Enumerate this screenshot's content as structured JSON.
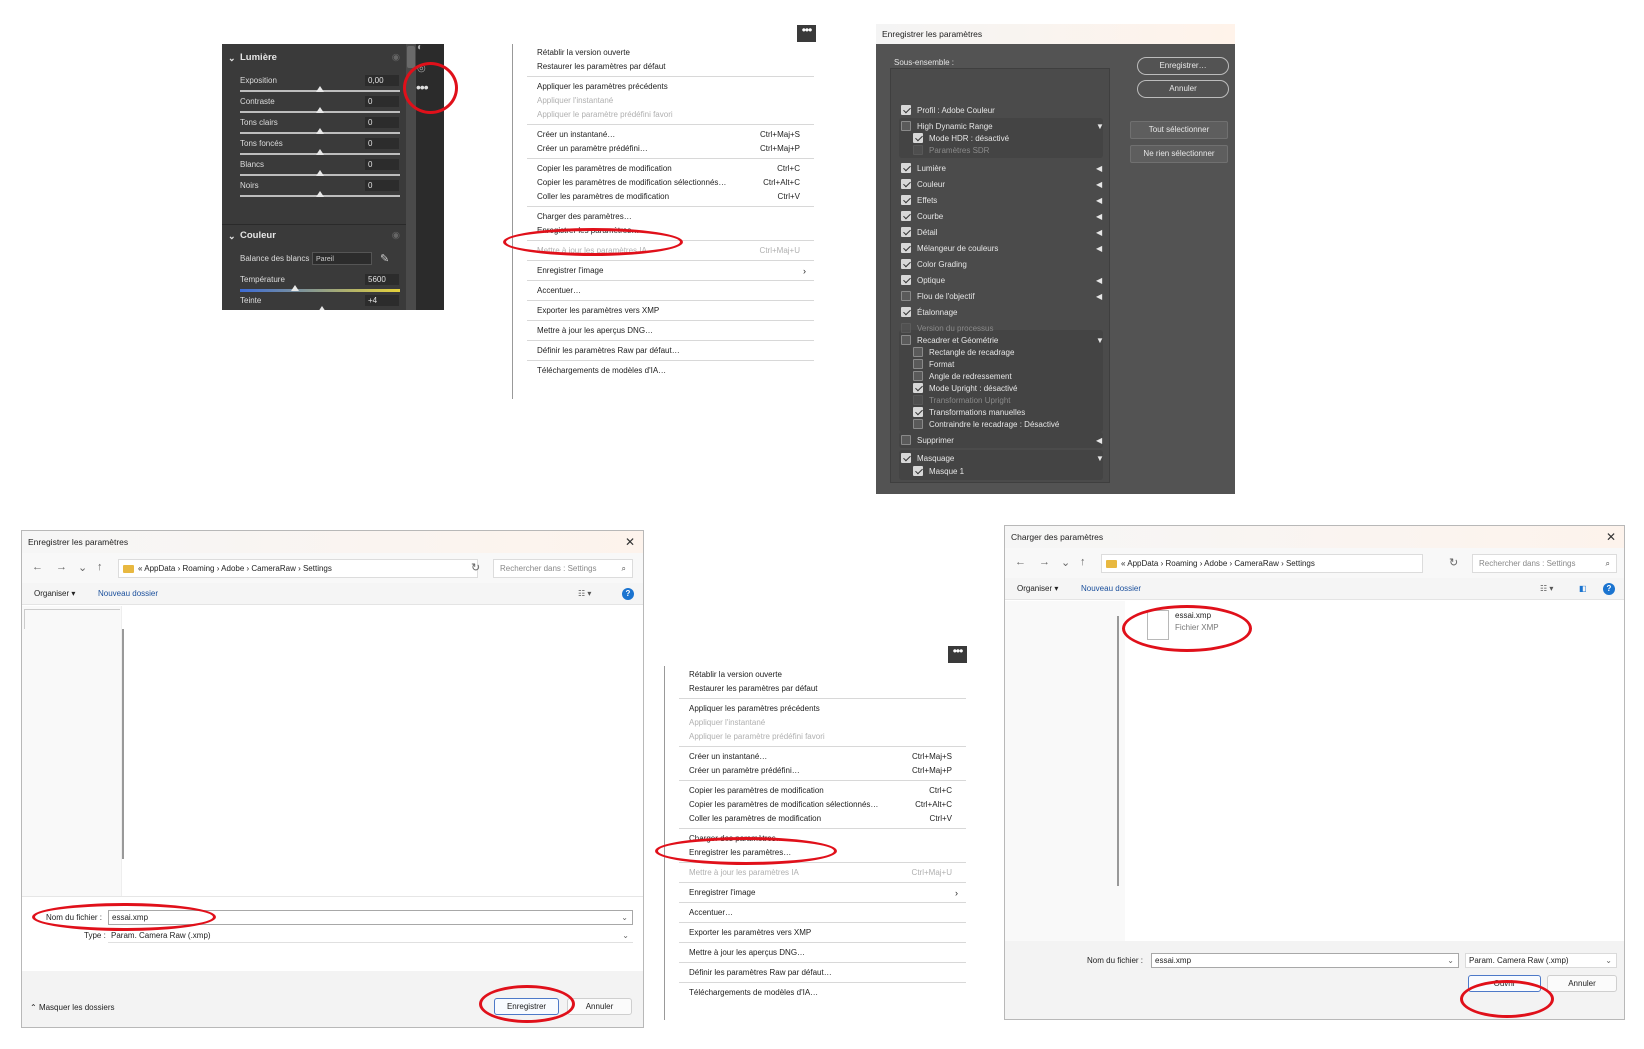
{
  "panel1": {
    "lumiere_title": "Lumière",
    "couleur_title": "Couleur",
    "sliders": [
      {
        "label": "Exposition",
        "value": "0,00"
      },
      {
        "label": "Contraste",
        "value": "0"
      },
      {
        "label": "Tons clairs",
        "value": "0"
      },
      {
        "label": "Tons foncés",
        "value": "0"
      },
      {
        "label": "Blancs",
        "value": "0"
      },
      {
        "label": "Noirs",
        "value": "0"
      }
    ],
    "wb_label": "Balance des blancs",
    "wb_value": "Pareil",
    "temperature_label": "Température",
    "temperature_value": "5600",
    "teinte_label": "Teinte",
    "teinte_value": "+4"
  },
  "menu1": {
    "more_glyph": "•••",
    "items": [
      {
        "label": "Rétablir la version ouverte",
        "shortcut": ""
      },
      {
        "label": "Restaurer les paramètres par défaut",
        "shortcut": ""
      },
      {
        "label": "Appliquer les paramètres précédents",
        "shortcut": ""
      },
      {
        "label": "Appliquer l'instantané",
        "shortcut": ""
      },
      {
        "label": "Appliquer le paramètre prédéfini favori",
        "shortcut": ""
      },
      {
        "label": "Créer un instantané…",
        "shortcut": "Ctrl+Maj+S"
      },
      {
        "label": "Créer un paramètre prédéfini…",
        "shortcut": "Ctrl+Maj+P"
      },
      {
        "label": "Copier les paramètres de modification",
        "shortcut": "Ctrl+C"
      },
      {
        "label": "Copier les paramètres de modification sélectionnés…",
        "shortcut": "Ctrl+Alt+C"
      },
      {
        "label": "Coller les paramètres de modification",
        "shortcut": "Ctrl+V"
      },
      {
        "label": "Charger des paramètres…",
        "shortcut": ""
      },
      {
        "label": "Enregistrer les paramètres…",
        "shortcut": ""
      },
      {
        "label": "Mettre à jour les paramètres IA",
        "shortcut": "Ctrl+Maj+U"
      },
      {
        "label": "Enregistrer l'image",
        "shortcut": ""
      },
      {
        "label": "Accentuer…",
        "shortcut": ""
      },
      {
        "label": "Exporter les paramètres vers XMP",
        "shortcut": ""
      },
      {
        "label": "Mettre à jour les aperçus DNG…",
        "shortcut": ""
      },
      {
        "label": "Définir les paramètres Raw par défaut…",
        "shortcut": ""
      },
      {
        "label": "Téléchargements de modèles d'IA…",
        "shortcut": ""
      }
    ]
  },
  "save_settings": {
    "title": "Enregistrer les paramètres",
    "subset_label": "Sous-ensemble :",
    "rows": [
      {
        "label": "Profil : Adobe Couleur"
      },
      {
        "label": "High Dynamic Range"
      },
      {
        "label": "Mode HDR : désactivé"
      },
      {
        "label": "Paramètres SDR"
      },
      {
        "label": "Lumière"
      },
      {
        "label": "Couleur"
      },
      {
        "label": "Effets"
      },
      {
        "label": "Courbe"
      },
      {
        "label": "Détail"
      },
      {
        "label": "Mélangeur de couleurs"
      },
      {
        "label": "Color Grading"
      },
      {
        "label": "Optique"
      },
      {
        "label": "Flou de l'objectif"
      },
      {
        "label": "Étalonnage"
      },
      {
        "label": "Version du processus"
      },
      {
        "label": "Recadrer et Géométrie"
      },
      {
        "label": "Rectangle de recadrage"
      },
      {
        "label": "Format"
      },
      {
        "label": "Angle de redressement"
      },
      {
        "label": "Mode Upright : désactivé"
      },
      {
        "label": "Transformation Upright"
      },
      {
        "label": "Transformations manuelles"
      },
      {
        "label": "Contraindre le recadrage : Désactivé"
      },
      {
        "label": "Supprimer"
      },
      {
        "label": "Masquage"
      },
      {
        "label": "Masque 1"
      }
    ],
    "btn_save": "Enregistrer…",
    "btn_cancel": "Annuler",
    "btn_select_all": "Tout sélectionner",
    "btn_select_none": "Ne rien sélectionner"
  },
  "save_dialog": {
    "title": "Enregistrer les paramètres",
    "path": "« AppData › Roaming › Adobe › CameraRaw › Settings",
    "search_placeholder": "Rechercher dans : Settings",
    "organise": "Organiser ▾",
    "new_folder": "Nouveau dossier",
    "filename_label": "Nom du fichier :",
    "filename_value": "essai.xmp",
    "type_label": "Type :",
    "type_value": "Param. Camera Raw (.xmp)",
    "hide_folders": "Masquer les dossiers",
    "btn_save": "Enregistrer",
    "btn_cancel": "Annuler"
  },
  "load_dialog": {
    "title": "Charger des paramètres",
    "path": "« AppData › Roaming › Adobe › CameraRaw › Settings",
    "search_placeholder": "Rechercher dans : Settings",
    "organise": "Organiser ▾",
    "new_folder": "Nouveau dossier",
    "file_name": "essai.xmp",
    "file_type": "Fichier XMP",
    "filename_label": "Nom du fichier :",
    "filename_value": "essai.xmp",
    "filter_value": "Param. Camera Raw (.xmp)",
    "btn_open": "Ouvrir",
    "btn_cancel": "Annuler"
  },
  "colors": {
    "highlight_ring": "#e0101a",
    "dark_panel": "#3a3a3a",
    "dialog_bg": "#535353"
  }
}
